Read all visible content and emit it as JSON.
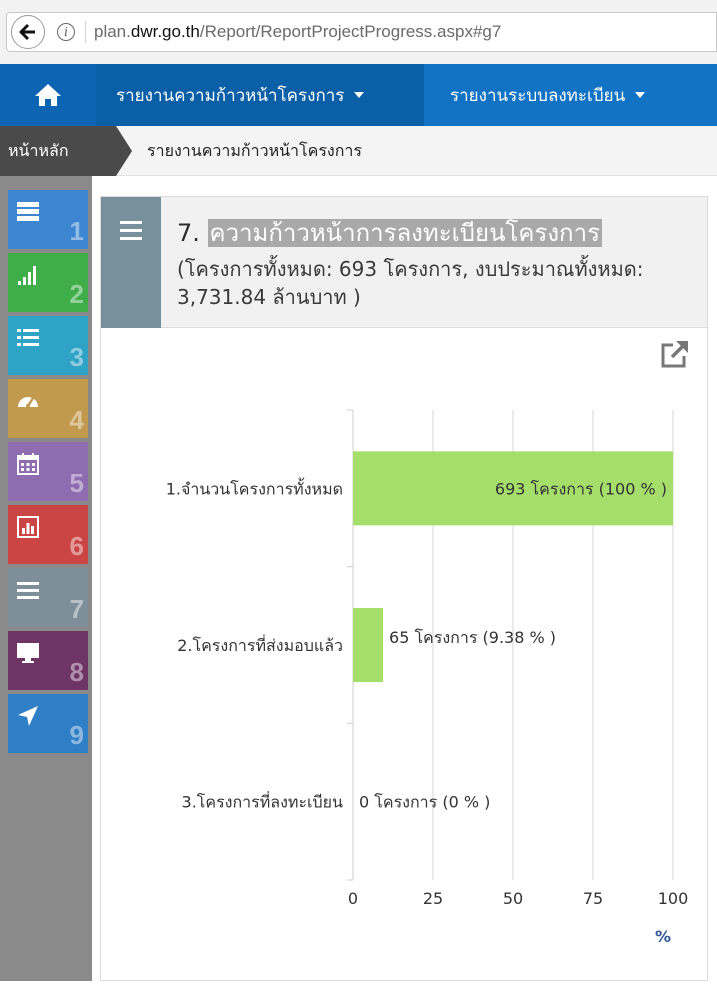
{
  "browser": {
    "url_prefix": "plan.",
    "url_host": "dwr.go.th",
    "url_path": "/Report/ReportProjectProgress.aspx#g7"
  },
  "nav": {
    "items": [
      {
        "label": "รายงานความก้าวหน้าโครงการ"
      },
      {
        "label": "รายงานระบบลงทะเบียน"
      }
    ]
  },
  "breadcrumb": {
    "home": "หน้าหลัก",
    "current": "รายงานความก้าวหน้าโครงการ"
  },
  "sidebar": {
    "tiles": [
      {
        "num": "1",
        "icon": "server-icon",
        "color": "#3d87d2"
      },
      {
        "num": "2",
        "icon": "signal-bars-icon",
        "color": "#3fae49"
      },
      {
        "num": "3",
        "icon": "list-icon",
        "color": "#2ea3c6"
      },
      {
        "num": "4",
        "icon": "dashboard-icon",
        "color": "#c29a4e"
      },
      {
        "num": "5",
        "icon": "calendar-icon",
        "color": "#8f6bb0"
      },
      {
        "num": "6",
        "icon": "bar-chart-icon",
        "color": "#cc4545"
      },
      {
        "num": "7",
        "icon": "bars-icon",
        "color": "#7f8f9a"
      },
      {
        "num": "8",
        "icon": "monitor-icon",
        "color": "#6e3466"
      },
      {
        "num": "9",
        "icon": "location-arrow-icon",
        "color": "#2f7fc6"
      }
    ]
  },
  "panel": {
    "title_num": "7.",
    "title": "ความก้าวหน้าการลงทะเบียนโครงการ",
    "subtitle": "(โครงการทั้งหมด: 693 โครงการ, งบประมาณทั้งหมด: 3,731.84 ล้านบาท )"
  },
  "chart_data": {
    "type": "bar",
    "orientation": "horizontal",
    "categories": [
      "1.จำนวนโครงการทั้งหมด",
      "2.โครงการที่ส่งมอบแล้ว",
      "3.โครงการที่ลงทะเบียน"
    ],
    "values": [
      100,
      9.38,
      0
    ],
    "data_labels": [
      "693 โครงการ (100 % )",
      "65 โครงการ (9.38 % )",
      "0 โครงการ (0 % )"
    ],
    "x_ticks": [
      "0",
      "25",
      "50",
      "75",
      "100"
    ],
    "xlim": [
      0,
      100
    ],
    "unit_label": "%",
    "bar_color": "#a6de6b",
    "grid": true
  }
}
